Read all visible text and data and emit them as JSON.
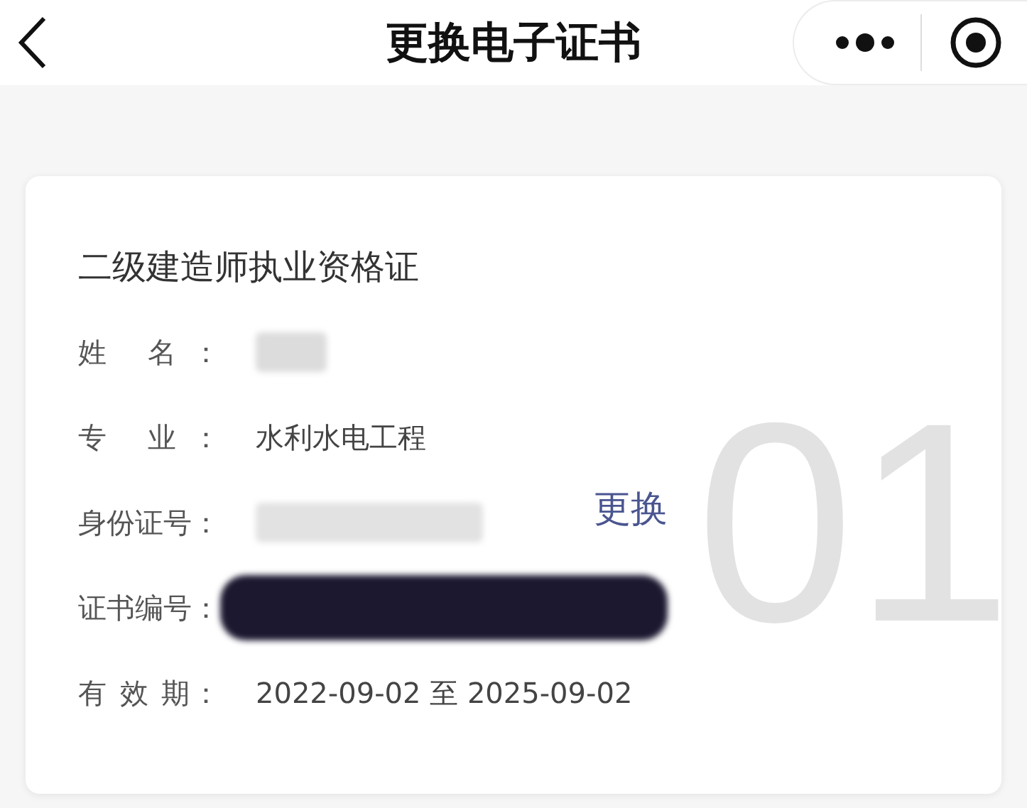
{
  "nav": {
    "title": "更换电子证书"
  },
  "card": {
    "title": "二级建造师执业资格证",
    "watermark": "01",
    "action": "更换",
    "fields": [
      {
        "label": "姓 名：",
        "kind": "redacted",
        "color": "#dcdcdc"
      },
      {
        "label": "专 业：",
        "kind": "text",
        "value": "水利水电工程"
      },
      {
        "label": "身份证号：",
        "kind": "redacted",
        "color": "#e2e2e2"
      },
      {
        "label": "证书编号：",
        "kind": "redacted",
        "color": "#1c1830"
      },
      {
        "label": "有 效 期：",
        "kind": "text",
        "value": "2022-09-02 至 2025-09-02"
      }
    ]
  }
}
